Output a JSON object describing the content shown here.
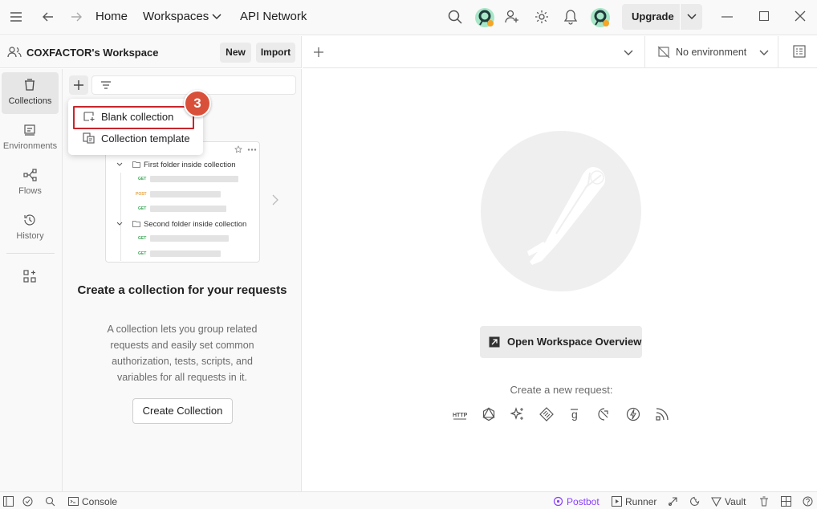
{
  "titlebar": {
    "home": "Home",
    "workspaces": "Workspaces",
    "api_network": "API Network",
    "upgrade": "Upgrade"
  },
  "workspace": {
    "name": "COXFACTOR's Workspace",
    "new_label": "New",
    "import_label": "Import"
  },
  "sidebar": {
    "items": [
      {
        "label": "Collections",
        "icon": "collections-icon"
      },
      {
        "label": "Environments",
        "icon": "environments-icon"
      },
      {
        "label": "Flows",
        "icon": "flows-icon"
      },
      {
        "label": "History",
        "icon": "history-icon"
      }
    ]
  },
  "menu": {
    "items": [
      {
        "label": "Blank collection",
        "icon": "blank-collection-icon"
      },
      {
        "label": "Collection template",
        "icon": "collection-template-icon"
      }
    ],
    "step_badge": "3"
  },
  "illustration": {
    "folder1": "First folder inside collection",
    "folder2": "Second folder inside collection",
    "methods": [
      "GET",
      "POST",
      "GET",
      "GET",
      "GET"
    ]
  },
  "placeholder": {
    "title": "Create a collection for your requests",
    "description": "A collection lets you group related requests and easily set common authorization, tests, scripts, and variables for all requests in it.",
    "button": "Create Collection"
  },
  "environment": {
    "selected": "No environment"
  },
  "main": {
    "open_overview": "Open Workspace Overview",
    "create_request_label": "Create a new request:",
    "request_types": [
      "http-icon",
      "graphql-icon",
      "ai-icon",
      "grpc-icon",
      "socketio-icon",
      "websocket-icon",
      "mqtt-icon",
      "rss-icon"
    ]
  },
  "statusbar": {
    "console": "Console",
    "postbot": "Postbot",
    "runner": "Runner",
    "vault": "Vault"
  },
  "colors": {
    "accent_red": "#c8262c",
    "badge": "#d9503a",
    "post_method": "#e8a33d",
    "get_method": "#3aa655",
    "postbot": "#8a3ffc"
  }
}
